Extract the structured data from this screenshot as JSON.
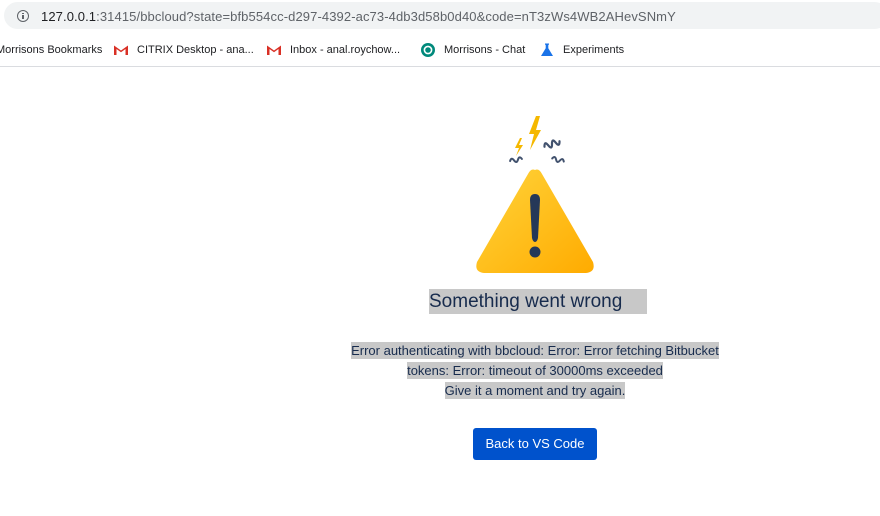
{
  "browser": {
    "url_host": "127.0.0.1",
    "url_rest": ":31415/bbcloud?state=bfb554cc-d297-4392-ac73-4db3d58b0d40&code=nT3zWs4WB2AHevSNmY"
  },
  "bookmarks": [
    {
      "label": "Morrisons Bookmarks",
      "icon": "folder-icon"
    },
    {
      "label": "CITRIX Desktop - ana...",
      "icon": "gmail-icon"
    },
    {
      "label": "Inbox - anal.roychow...",
      "icon": "gmail-icon"
    },
    {
      "label": "Morrisons - Chat",
      "icon": "chat-icon"
    },
    {
      "label": "Experiments",
      "icon": "flask-icon"
    }
  ],
  "error": {
    "title": "Something went wrong",
    "message_line1": "Error authenticating with bbcloud: Error: Error fetching Bitbucket",
    "message_line2": "tokens: Error: timeout of 30000ms exceeded",
    "message_line3": "Give it a moment and try again."
  },
  "actions": {
    "back_label": "Back to VS Code"
  },
  "colors": {
    "button": "#0052cc",
    "warning_yellow": "#ffc400",
    "text": "#172b4d"
  }
}
